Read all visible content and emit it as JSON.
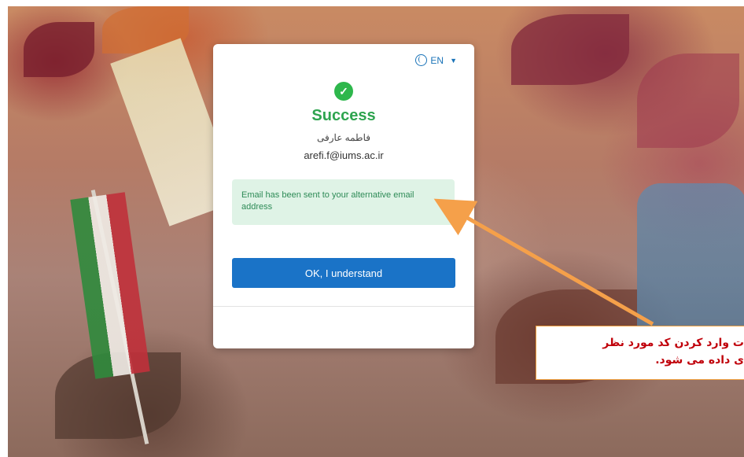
{
  "language": {
    "label": "EN",
    "icon": "globe-icon",
    "caret": "▼"
  },
  "status": {
    "icon": "check-circle-icon",
    "title": "Success",
    "full_name": "فاطمه عارفی",
    "email": "arefi.f@iums.ac.ir"
  },
  "alert": {
    "message": "Email has been sent to your alternative email address"
  },
  "ok_button": {
    "label": "OK, I understand"
  },
  "annotation": {
    "line1": "ت وارد کردن کد مورد نظر",
    "line2": "ی داده می شود."
  },
  "colors": {
    "success": "#2eb74c",
    "primary": "#1a73c7",
    "alert_bg": "#dff3e6",
    "annotation_border": "#f0a040",
    "annotation_text": "#c0000a",
    "arrow": "#f5a04a"
  }
}
